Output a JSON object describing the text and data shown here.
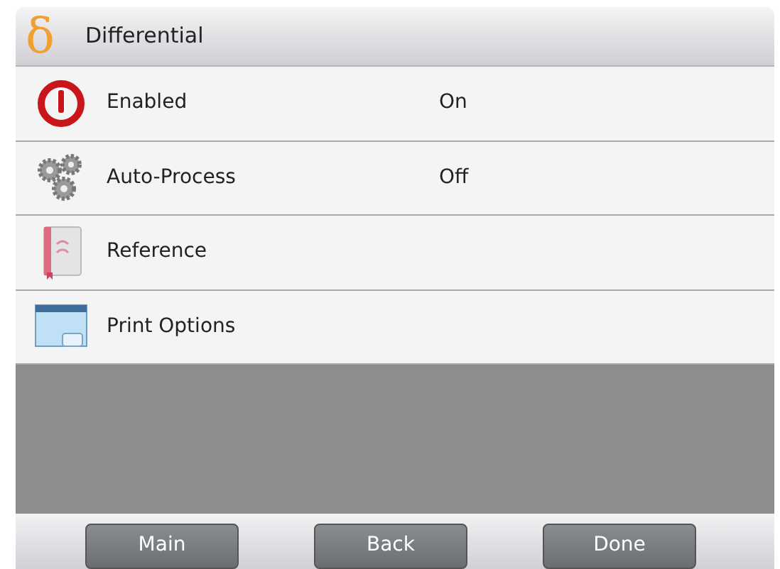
{
  "header": {
    "symbol": "δ",
    "title": "Differential"
  },
  "items": [
    {
      "kind": "power",
      "label": "Enabled",
      "value": "On"
    },
    {
      "kind": "gears",
      "label": "Auto-Process",
      "value": "Off"
    },
    {
      "kind": "book",
      "label": "Reference"
    },
    {
      "kind": "print",
      "label": "Print Options"
    }
  ],
  "buttons": [
    "Main",
    "Back",
    "Done"
  ]
}
